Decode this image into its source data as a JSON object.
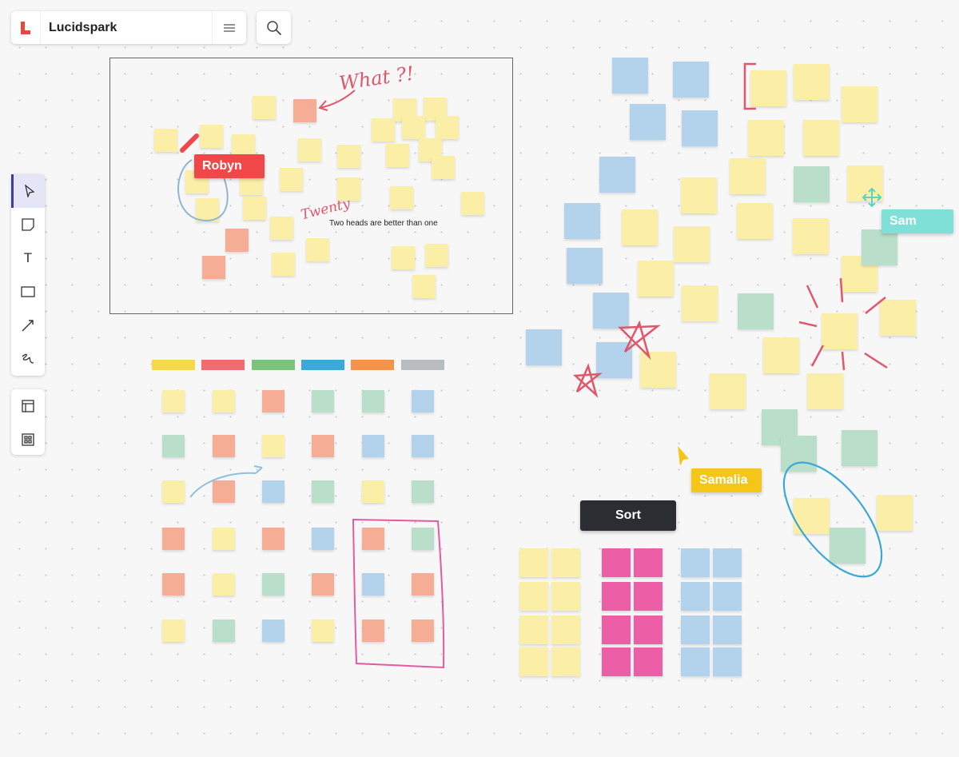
{
  "header": {
    "app_name": "Lucidspark",
    "menu_icon": "hamburger-icon",
    "search_icon": "search-icon"
  },
  "toolbar": {
    "tools": [
      "select-icon",
      "sticky-note-icon",
      "text-icon",
      "rectangle-icon",
      "line-icon",
      "freehand-icon"
    ],
    "extras": [
      "frame-icon",
      "grid-icon"
    ],
    "text_tool_glyph": "T"
  },
  "frame": {
    "text": "Two heads are better than one",
    "handwritten_what": "What ?!",
    "handwritten_twenty": "Twenty"
  },
  "collaborators": [
    {
      "name": "Robyn",
      "color": "#f04848"
    },
    {
      "name": "Sam",
      "color": "#7ee0d6"
    },
    {
      "name": "Samalia",
      "color": "#f5c518"
    }
  ],
  "sort_button": {
    "label": "Sort"
  },
  "category_colors": [
    "#f5d949",
    "#f26b6f",
    "#7dc37a",
    "#3aa9dc",
    "#f5934a",
    "#b9bdbf"
  ],
  "sticky_colors": {
    "yellow": "#fbefa8",
    "salmon": "#f6ad95",
    "green": "#b9dfcb",
    "blue": "#b3d3ec",
    "pink": "#ec5ea6"
  }
}
